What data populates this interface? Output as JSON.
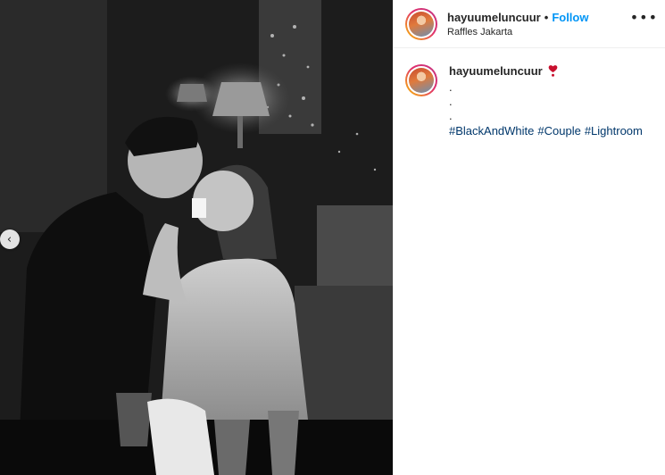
{
  "post": {
    "username": "hayuumeluncuur",
    "follow_label": "Follow",
    "separator": "•",
    "location": "Raffles Jakarta",
    "more_glyph": "•••",
    "prev_glyph": "‹"
  },
  "caption": {
    "username": "hayuumeluncuur",
    "emoji_icon": "red-heart-exclamation-icon",
    "dot_lines": [
      ".",
      ".",
      "."
    ],
    "hashtags": [
      "#BlackAndWhite",
      "#Couple",
      "#Lightroom"
    ]
  },
  "colors": {
    "follow_blue": "#0095f6",
    "hashtag_blue": "#00376b",
    "heart_red": "#c8102e"
  }
}
